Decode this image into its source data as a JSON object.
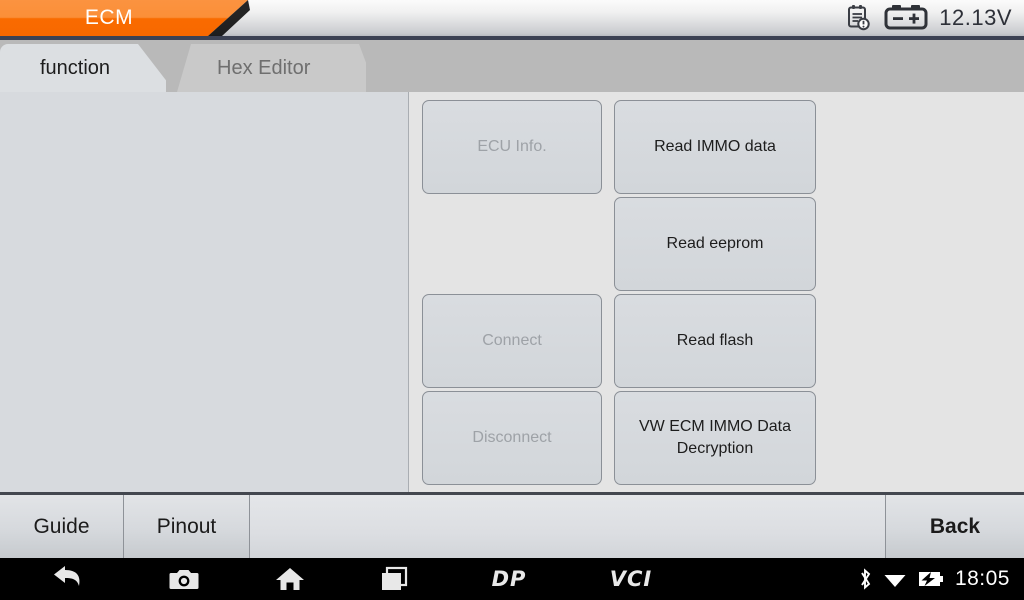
{
  "header": {
    "title": "ECM",
    "voltage": "12.13V",
    "icons": [
      {
        "name": "report-clock-icon"
      },
      {
        "name": "battery-voltage-icon"
      }
    ]
  },
  "tabs": [
    {
      "label": "function",
      "active": true
    },
    {
      "label": "Hex Editor",
      "active": false
    }
  ],
  "functions": [
    {
      "label": "ECU Info.",
      "enabled": false,
      "column": 1,
      "row": 1
    },
    {
      "label": "Read IMMO data",
      "enabled": true,
      "column": 2,
      "row": 1
    },
    {
      "label": "Read eeprom",
      "enabled": true,
      "column": 2,
      "row": 2
    },
    {
      "label": "Connect",
      "enabled": false,
      "column": 1,
      "row": 3
    },
    {
      "label": "Read flash",
      "enabled": true,
      "column": 2,
      "row": 3
    },
    {
      "label": "Disconnect",
      "enabled": false,
      "column": 1,
      "row": 4
    },
    {
      "label": "VW ECM IMMO Data Decryption",
      "enabled": true,
      "column": 2,
      "row": 4
    }
  ],
  "toolbar": {
    "guide_label": "Guide",
    "pinout_label": "Pinout",
    "back_label": "Back"
  },
  "navbar": {
    "items": [
      {
        "name": "back-icon"
      },
      {
        "name": "screenshot-camera-icon"
      },
      {
        "name": "home-icon"
      },
      {
        "name": "recents-icon"
      },
      {
        "name": "dp-logo",
        "text": "DP"
      },
      {
        "name": "vci-logo",
        "text": "VCI"
      }
    ],
    "status": {
      "bluetooth": "bluetooth-icon",
      "wifi": "wifi-icon",
      "battery": "battery-charging-icon",
      "clock": "18:05"
    }
  },
  "colors": {
    "accent_orange": "#f96b00",
    "accent_orange_light": "#fb9340",
    "header_border": "#3c4254",
    "panel": "#d7dade",
    "content_bg": "#e4e4e4",
    "tabstrip": "#b9b9b9",
    "disabled_text": "#9ea2a7"
  }
}
